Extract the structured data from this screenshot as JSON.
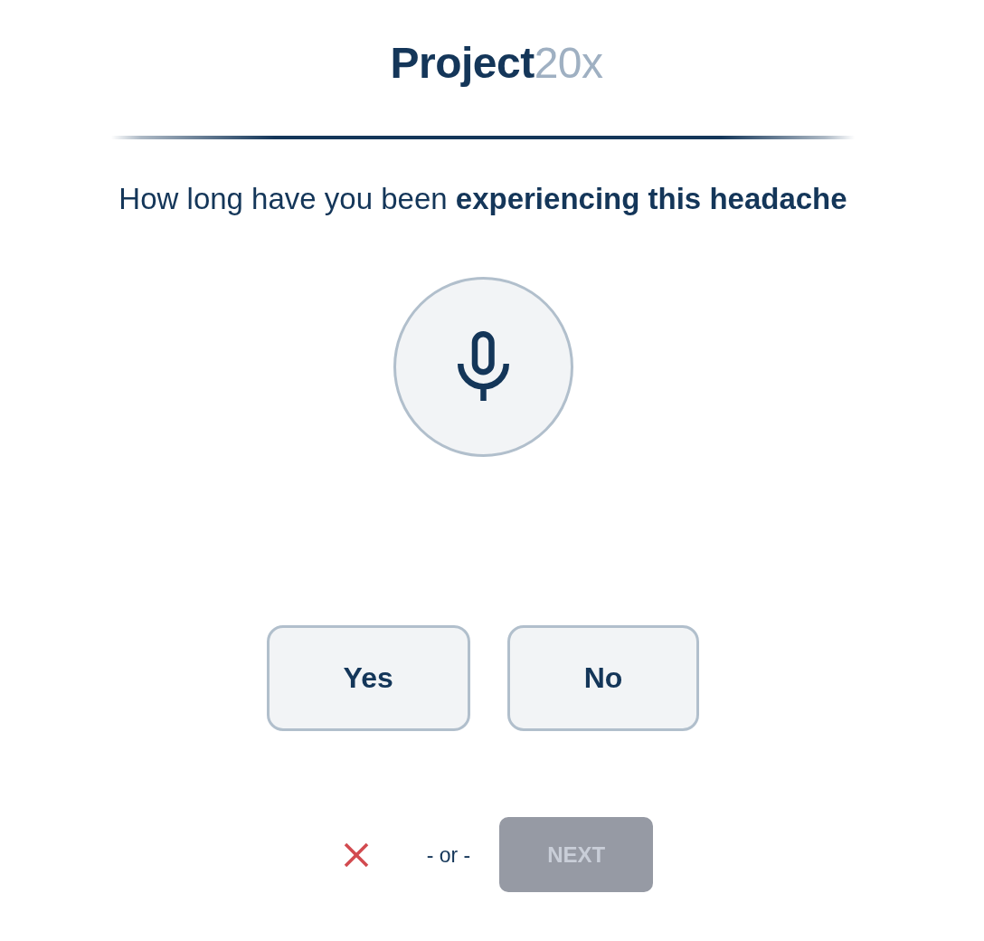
{
  "logo": "**Project**20x",
  "question": "How long have you been **experiencing this headache**",
  "answers": [
    {
      "label": "Yes",
      "selected": false
    },
    {
      "label": "No",
      "selected": false
    }
  ],
  "footer": {
    "separator": "- or -",
    "next_button": {
      "label": "NEXT",
      "disabled": true
    }
  }
}
